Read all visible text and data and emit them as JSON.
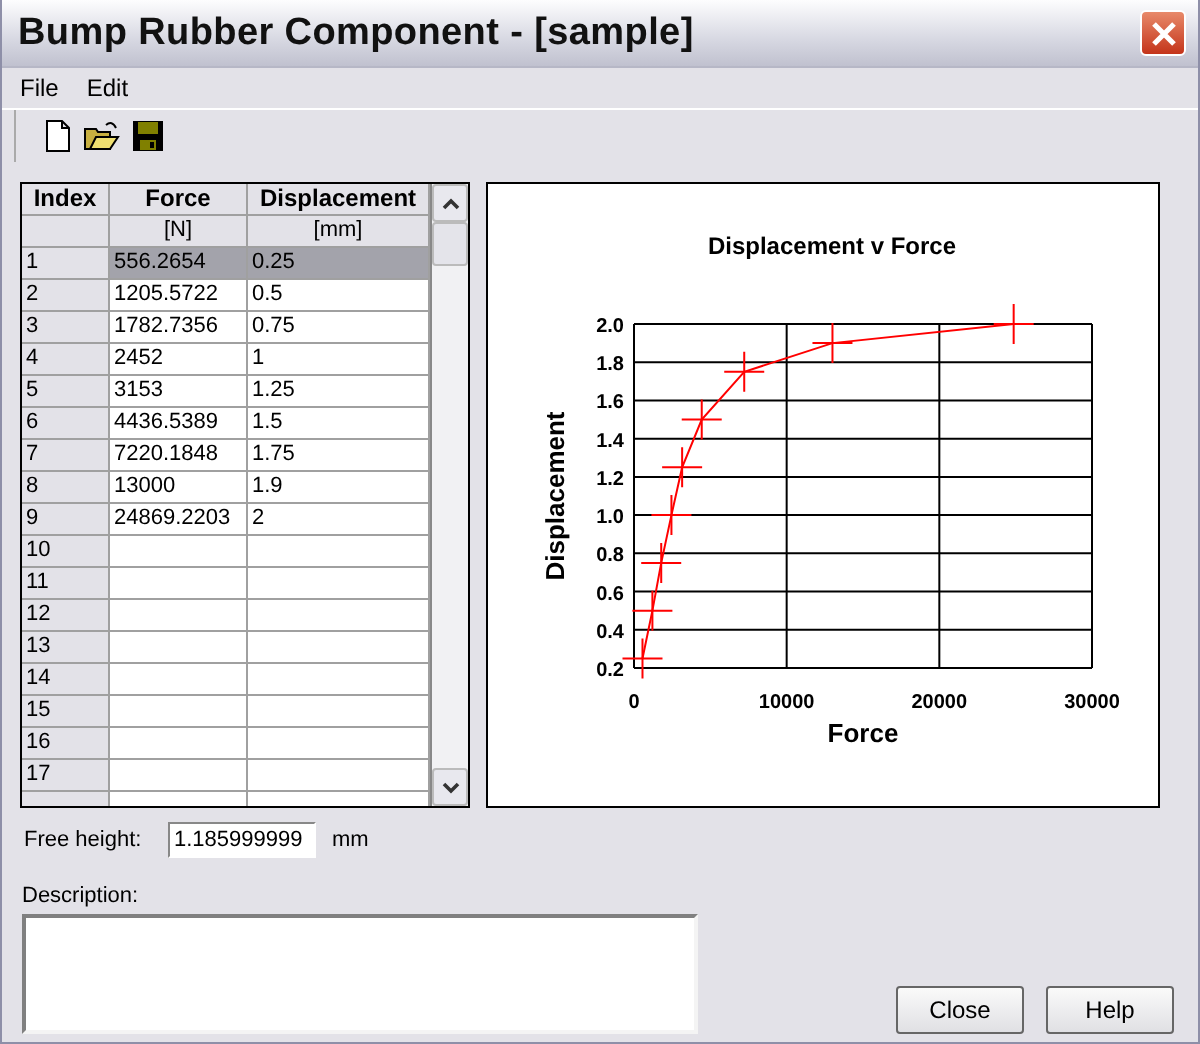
{
  "window": {
    "title": "Bump Rubber Component - [sample]"
  },
  "menu": [
    "File",
    "Edit"
  ],
  "table": {
    "columns": [
      {
        "name": "Index"
      },
      {
        "name": "Force",
        "unit": "[N]"
      },
      {
        "name": "Displacement",
        "unit": "[mm]"
      }
    ],
    "rows": [
      {
        "index": "1",
        "force": "556.2654",
        "displacement": "0.25",
        "selected": true
      },
      {
        "index": "2",
        "force": "1205.5722",
        "displacement": "0.5",
        "selected": false
      },
      {
        "index": "3",
        "force": "1782.7356",
        "displacement": "0.75",
        "selected": false
      },
      {
        "index": "4",
        "force": "2452",
        "displacement": "1",
        "selected": false
      },
      {
        "index": "5",
        "force": "3153",
        "displacement": "1.25",
        "selected": false
      },
      {
        "index": "6",
        "force": "4436.5389",
        "displacement": "1.5",
        "selected": false
      },
      {
        "index": "7",
        "force": "7220.1848",
        "displacement": "1.75",
        "selected": false
      },
      {
        "index": "8",
        "force": "13000",
        "displacement": "1.9",
        "selected": false
      },
      {
        "index": "9",
        "force": "24869.2203",
        "displacement": "2",
        "selected": false
      },
      {
        "index": "10",
        "force": "",
        "displacement": "",
        "selected": false
      },
      {
        "index": "11",
        "force": "",
        "displacement": "",
        "selected": false
      },
      {
        "index": "12",
        "force": "",
        "displacement": "",
        "selected": false
      },
      {
        "index": "13",
        "force": "",
        "displacement": "",
        "selected": false
      },
      {
        "index": "14",
        "force": "",
        "displacement": "",
        "selected": false
      },
      {
        "index": "15",
        "force": "",
        "displacement": "",
        "selected": false
      },
      {
        "index": "16",
        "force": "",
        "displacement": "",
        "selected": false
      },
      {
        "index": "17",
        "force": "",
        "displacement": "",
        "selected": false
      }
    ]
  },
  "chart": {
    "chart_data": {
      "type": "line",
      "title": "Displacement v Force",
      "xlabel": "Force",
      "ylabel": "Displacement",
      "x": [
        556.2654,
        1205.5722,
        1782.7356,
        2452,
        3153,
        4436.5389,
        7220.1848,
        13000,
        24869.2203
      ],
      "grid": true,
      "series": [
        {
          "color": "#ff0000",
          "marker": "+",
          "values": [
            0.25,
            0.5,
            0.75,
            1,
            1.25,
            1.5,
            1.75,
            1.9,
            2
          ]
        }
      ],
      "xlim": [
        0,
        30000
      ],
      "ylim": [
        0.2,
        2.0
      ],
      "xticks": [
        0,
        10000,
        20000,
        30000
      ],
      "yticks": [
        {
          "value": 0.2,
          "label": "0.2"
        },
        {
          "value": 0.4,
          "label": "0.4"
        },
        {
          "value": 0.6,
          "label": "0.6"
        },
        {
          "value": 0.8,
          "label": "0.8"
        },
        {
          "value": 1.0,
          "label": "1.0"
        },
        {
          "value": 1.2,
          "label": "1.2"
        },
        {
          "value": 1.4,
          "label": "1.4"
        },
        {
          "value": 1.6,
          "label": "1.6"
        },
        {
          "value": 1.8,
          "label": "1.8"
        },
        {
          "value": 2.0,
          "label": "2.0"
        }
      ]
    }
  },
  "free_height": {
    "label": "Free height:",
    "value": "1.185999999",
    "unit": "mm"
  },
  "description": {
    "label": "Description:"
  },
  "buttons": [
    "Close",
    "Help"
  ]
}
